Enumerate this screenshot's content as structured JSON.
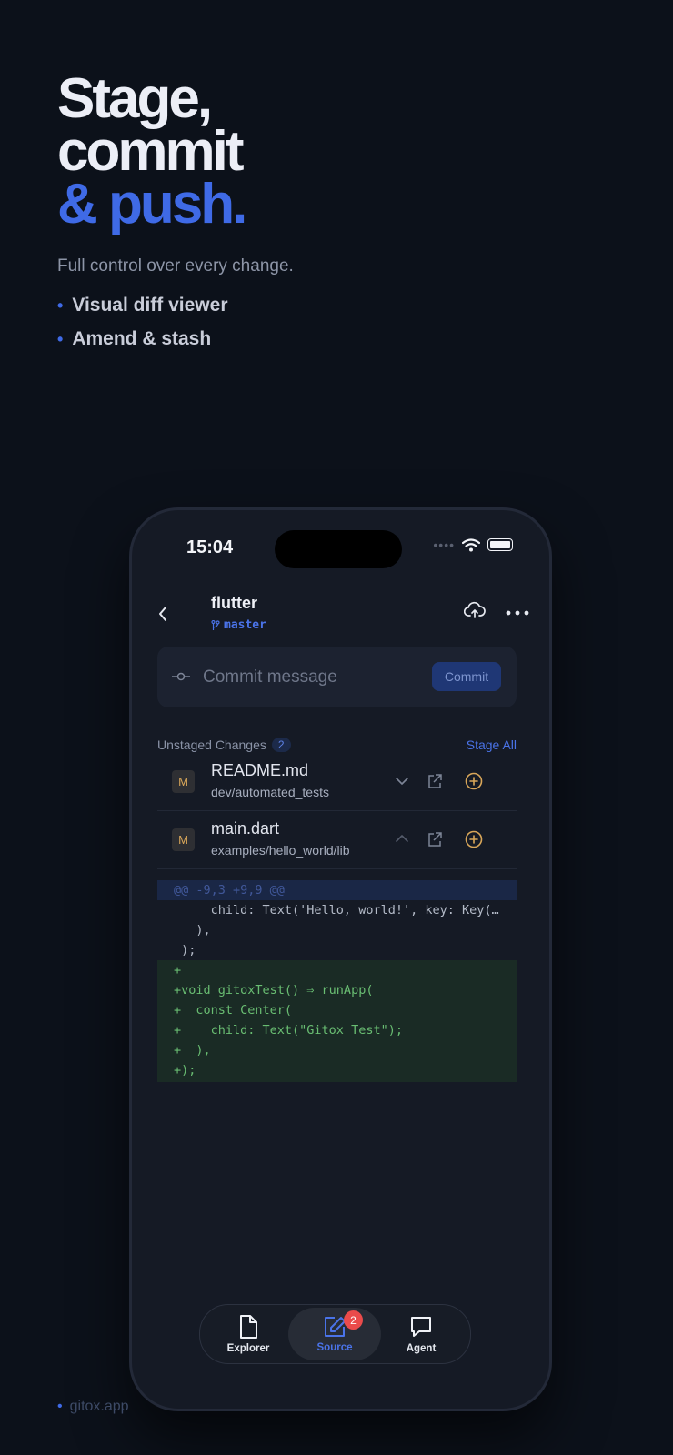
{
  "hero": {
    "line1": "Stage,",
    "line2": "commit",
    "line3": "& push.",
    "subtitle": "Full control over every change.",
    "features": [
      "Visual diff viewer",
      "Amend & stash"
    ]
  },
  "footer": {
    "url": "gitox.app"
  },
  "status_bar": {
    "time": "15:04"
  },
  "header": {
    "repo": "flutter",
    "branch": "master"
  },
  "commit": {
    "placeholder": "Commit message",
    "button": "Commit"
  },
  "changes": {
    "title": "Unstaged Changes",
    "count": "2",
    "stage_all": "Stage All",
    "files": [
      {
        "status": "M",
        "name": "README.md",
        "path": "dev/automated_tests"
      },
      {
        "status": "M",
        "name": "main.dart",
        "path": "examples/hello_world/lib"
      }
    ]
  },
  "diff": {
    "lines": [
      "@@ -9,3 +9,9 @@",
      "     child: Text('Hello, world!', key: Key(…",
      "   ),",
      " );",
      "+",
      "+void gitoxTest() ⇒ runApp(",
      "+  const Center(",
      "+    child: Text(\"Gitox Test\");",
      "+  ),",
      "+);"
    ]
  },
  "tabbar": {
    "explorer": "Explorer",
    "source": "Source",
    "source_badge": "2",
    "agent": "Agent"
  },
  "colors": {
    "accent": "#3f6ae6",
    "background": "#0c111a",
    "added": "#69bd72",
    "modified": "#d8a659",
    "badge": "#ea4b4b"
  }
}
